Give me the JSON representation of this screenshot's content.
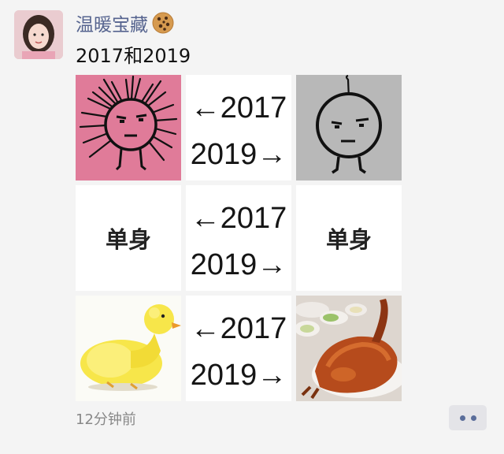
{
  "post": {
    "username": "温暖宝藏",
    "text": "2017和2019",
    "timestamp": "12分钟前"
  },
  "grid": {
    "arrow_left": "←2017",
    "arrow_right": "2019→",
    "single_label": "单身"
  },
  "icons": {
    "username_emoji": "cookie-icon",
    "more": "more-dots-icon"
  },
  "colors": {
    "username": "#56648f",
    "pink_background": "#e07b99",
    "gray_background": "#b8b8b8",
    "duckling": "#f7e64a",
    "roast_duck": "#b64b1c"
  }
}
